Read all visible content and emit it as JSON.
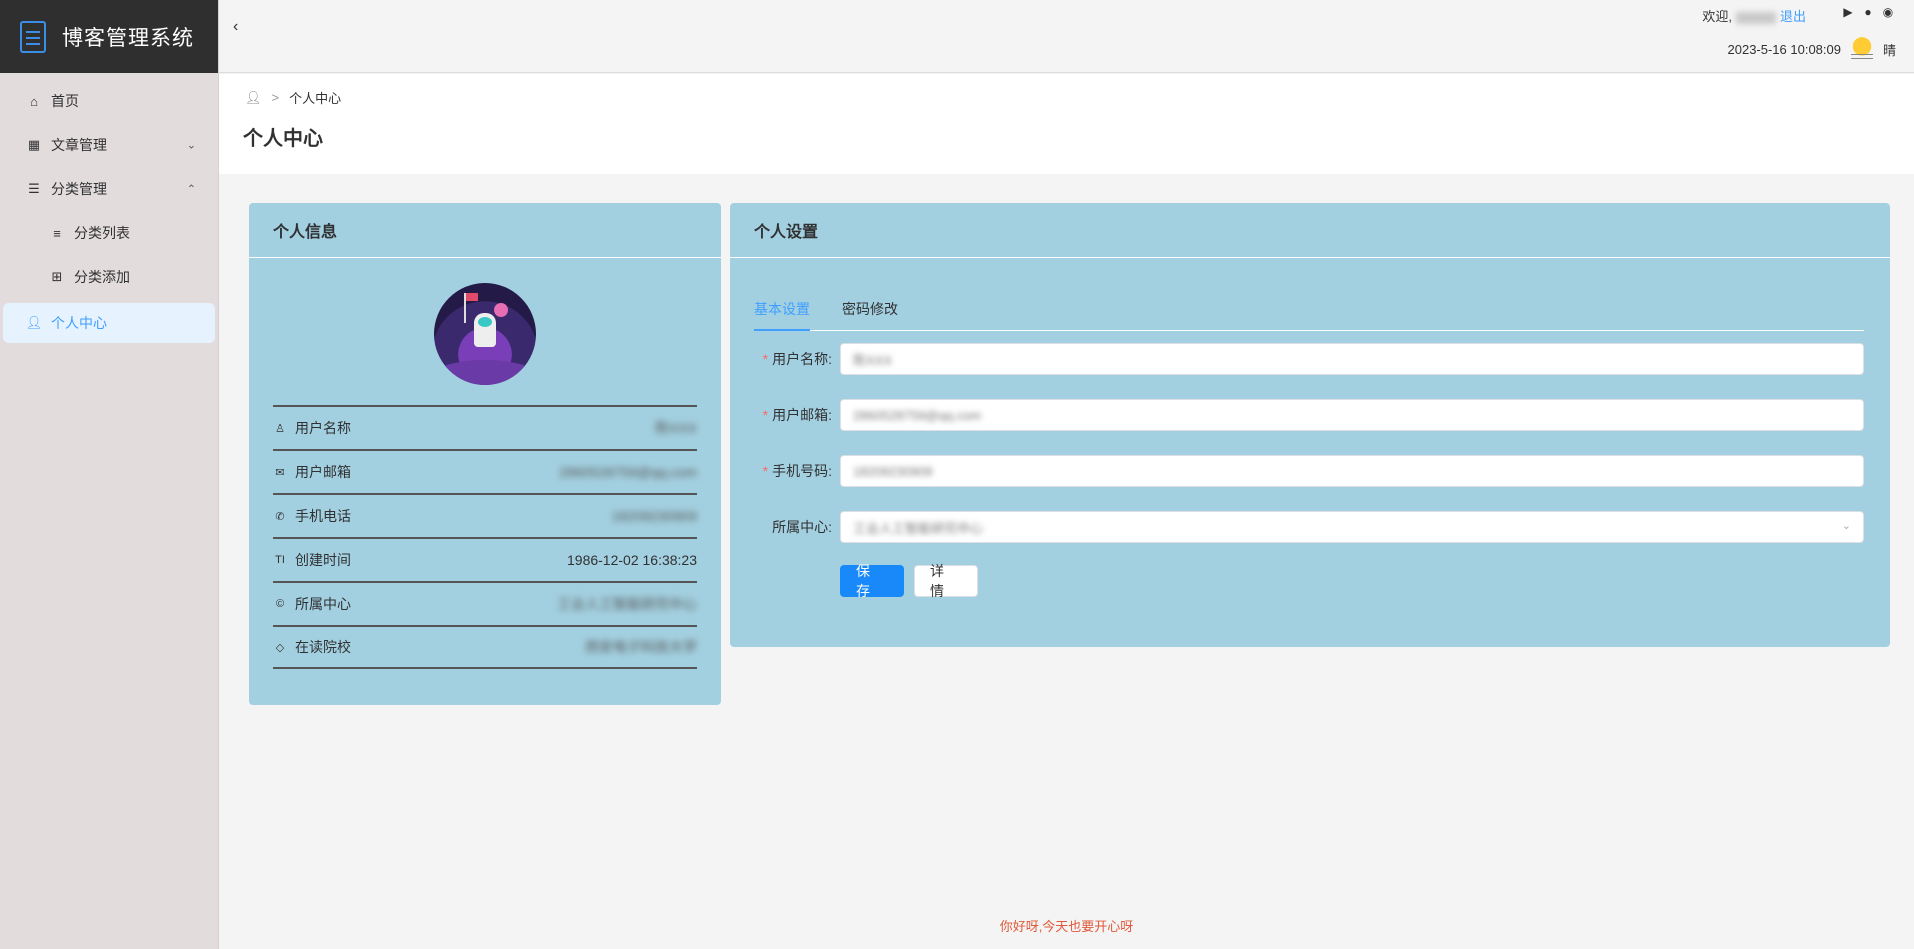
{
  "app": {
    "title": "博客管理系统"
  },
  "sidebar": {
    "items": [
      {
        "label": "首页",
        "icon": "home-icon"
      },
      {
        "label": "文章管理",
        "icon": "grid-icon"
      },
      {
        "label": "分类管理",
        "icon": "list-indent-icon"
      },
      {
        "label": "分类列表",
        "icon": "list-icon"
      },
      {
        "label": "分类添加",
        "icon": "add-grid-icon"
      },
      {
        "label": "个人中心",
        "icon": "user-icon"
      }
    ]
  },
  "header": {
    "welcome": "欢迎,",
    "logout": "退出",
    "datetime": "2023-5-16 10:08:09",
    "weather": "晴"
  },
  "breadcrumb": {
    "current": "个人中心"
  },
  "page": {
    "title": "个人中心"
  },
  "profile_card": {
    "title": "个人信息",
    "rows": [
      {
        "label": "用户名称",
        "value": "陈XXX",
        "icon": "user-outline-icon"
      },
      {
        "label": "用户邮箱",
        "value": "2860528759@qq.com",
        "icon": "mail-icon"
      },
      {
        "label": "手机电话",
        "value": "18209230909",
        "icon": "phone-icon"
      },
      {
        "label": "创建时间",
        "value": "1986-12-02 16:38:23",
        "icon": "text-icon"
      },
      {
        "label": "所属中心",
        "value": "工业人工智能研究中心",
        "icon": "copyright-icon"
      },
      {
        "label": "在读院校",
        "value": "西安电子科技大学",
        "icon": "tag-icon"
      }
    ]
  },
  "settings_card": {
    "title": "个人设置",
    "tabs": [
      {
        "label": "基本设置"
      },
      {
        "label": "密码修改"
      }
    ],
    "fields": [
      {
        "label": "用户名称:",
        "value": "陈XXX",
        "required": true
      },
      {
        "label": "用户邮箱:",
        "value": "2860528759@qq.com",
        "required": true
      },
      {
        "label": "手机号码:",
        "value": "18209230909",
        "required": true
      },
      {
        "label": "所属中心:",
        "value": "工业人工智能研究中心",
        "required": false
      }
    ],
    "save_label": "保 存",
    "detail_label": "详 情"
  },
  "footer": {
    "text": "你好呀,今天也要开心呀"
  },
  "colors": {
    "accent": "#409eff",
    "card_bg": "#a3d0e0",
    "sidebar_bg": "#e3dcdc",
    "brand_bg": "#2f2f2f"
  }
}
